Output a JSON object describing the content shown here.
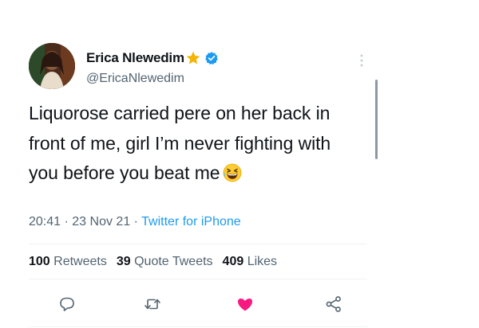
{
  "tweet": {
    "display_name": "Erica Nlewedim",
    "handle": "@EricaNlewedim",
    "text": "Liquorose carried pere on her back in front of me, girl I’m never fighting with you before you beat me",
    "time": "20:41",
    "separator": "·",
    "date": "23 Nov 21",
    "source": "Twitter for iPhone"
  },
  "stats": {
    "retweets_count": "100",
    "retweets_label": "Retweets",
    "quotes_count": "39",
    "quotes_label": "Quote Tweets",
    "likes_count": "409",
    "likes_label": "Likes"
  },
  "icons": {
    "name_badge": "star-icon",
    "verified": "verified-icon",
    "menu": "more-icon",
    "emoji": "grinning-squinting-face-icon",
    "reply": "reply-icon",
    "retweet": "retweet-icon",
    "like": "heart-icon",
    "share": "share-icon"
  },
  "colors": {
    "accent": "#1d9bf0",
    "liked": "#f91880",
    "secondary_text": "#536471",
    "star": "#f5b400"
  }
}
